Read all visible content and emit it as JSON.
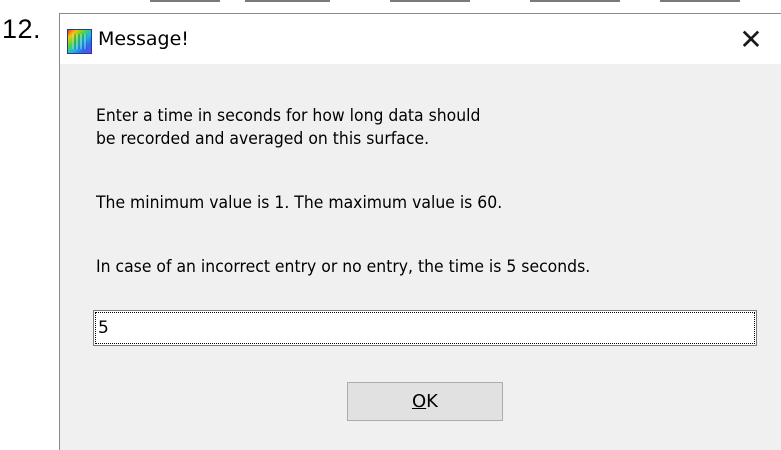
{
  "step": {
    "number": "12."
  },
  "dialog": {
    "title": "Message!",
    "icon": "app-icon",
    "close_glyph": "✕",
    "message": {
      "line1": "Enter a time in seconds for how long data should",
      "line2": "be recorded and averaged on this surface.",
      "range": "The minimum value is 1. The maximum value is 60.",
      "default_note": "In case of an incorrect entry or no entry, the time is 5 seconds."
    },
    "input": {
      "value": "5",
      "placeholder": ""
    },
    "ok_button": {
      "mnemonic": "O",
      "rest": "K"
    }
  },
  "colors": {
    "dialog_bg": "#f0f0f0",
    "title_bg": "#ffffff",
    "button_bg": "#e1e1e1"
  }
}
